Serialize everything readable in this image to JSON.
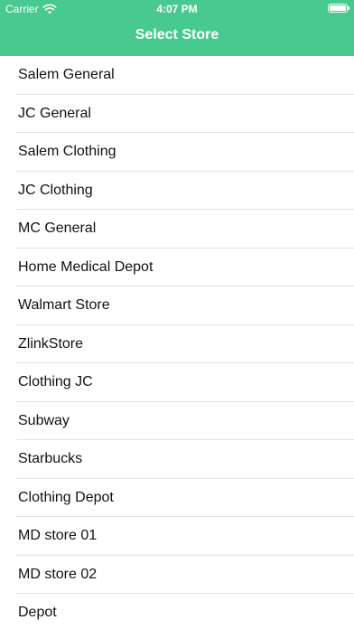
{
  "status_bar": {
    "carrier": "Carrier",
    "time": "4:07 PM"
  },
  "header": {
    "title": "Select Store",
    "color": "#48c98f"
  },
  "stores": [
    "Salem General",
    "JC General",
    "Salem Clothing",
    "JC Clothing",
    "MC General",
    "Home Medical Depot",
    "Walmart Store",
    "ZlinkStore",
    "Clothing JC",
    "Subway",
    "Starbucks",
    "Clothing Depot",
    "MD store 01",
    "MD store 02",
    "Depot"
  ]
}
